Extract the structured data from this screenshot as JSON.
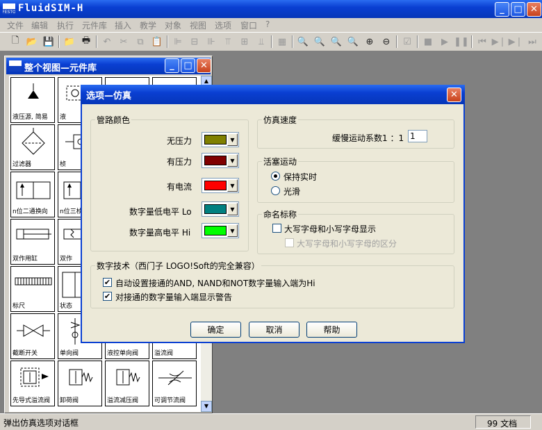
{
  "app": {
    "title": "FluidSIM-H"
  },
  "menu": [
    "文件",
    "编辑",
    "执行",
    "元件库",
    "插入",
    "教学",
    "对象",
    "视图",
    "选项",
    "窗口",
    "?"
  ],
  "toolbar": {
    "icons": [
      "new-file-icon",
      "open-folder-icon",
      "save-icon",
      "open-project-icon",
      "print-icon",
      "undo-icon",
      "cut-icon",
      "copy-icon",
      "paste-icon",
      "align-left-icon",
      "align-center-icon",
      "align-right-icon",
      "align-top-icon",
      "align-middle-icon",
      "align-bottom-icon",
      "grid-icon",
      "zoom-fit-icon",
      "zoom-prev-icon",
      "zoom-window-icon",
      "zoom-all-icon",
      "zoom-in-icon",
      "zoom-out-icon",
      "check-icon",
      "stop-icon",
      "play-icon",
      "pause-icon",
      "rewind-icon",
      "step-icon",
      "forward-icon",
      "fast-forward-icon"
    ]
  },
  "library": {
    "title": "整个视图—元件库",
    "cells": [
      {
        "label": "液压源, 简易",
        "icon": "hydraulic-source-icon"
      },
      {
        "label": "液",
        "icon": "pump-icon"
      },
      {
        "label": "",
        "icon": "blank-icon"
      },
      {
        "label": "",
        "icon": "blank-icon"
      },
      {
        "label": "过滤器",
        "icon": "filter-icon"
      },
      {
        "label": "桢",
        "icon": "valve-icon"
      },
      {
        "label": "n位二通换向",
        "icon": "way-valve-2-icon"
      },
      {
        "label": "n位三桢",
        "icon": "way-valve-3-icon"
      },
      {
        "label": "双作用缸",
        "icon": "double-acting-cylinder-icon"
      },
      {
        "label": "双作",
        "icon": "cylinder-icon"
      },
      {
        "label": "标尺",
        "icon": "scale-icon"
      },
      {
        "label": "状态",
        "icon": "state-icon"
      },
      {
        "label": "截断开关",
        "icon": "shutoff-valve-icon"
      },
      {
        "label": "单向阀",
        "icon": "check-valve-icon"
      },
      {
        "label": "液控单向阀",
        "icon": "pilot-check-valve-icon"
      },
      {
        "label": "溢流阀",
        "icon": "relief-valve-icon"
      },
      {
        "label": "先导式溢流阀",
        "icon": "pilot-relief-valve-icon"
      },
      {
        "label": "卸荷阀",
        "icon": "unloading-valve-icon"
      },
      {
        "label": "溢流减压阀",
        "icon": "pressure-reducing-valve-icon"
      },
      {
        "label": "可调节流阀",
        "icon": "throttle-valve-icon"
      }
    ]
  },
  "dialog": {
    "title": "选项—仿真",
    "pipe_colors": {
      "group": "管路颜色",
      "rows": [
        {
          "label": "无压力",
          "color": "#808000"
        },
        {
          "label": "有压力",
          "color": "#800000"
        },
        {
          "label": "有电流",
          "color": "#ff0000"
        },
        {
          "label": "数字量低电平 Lo",
          "color": "#008080"
        },
        {
          "label": "数字量高电平 Hi",
          "color": "#00ff00"
        }
      ]
    },
    "sim_speed": {
      "group": "仿真速度",
      "label": "缓慢运动系数1 ：1",
      "value": "1"
    },
    "piston": {
      "group": "活塞运动",
      "options": [
        "保持实时",
        "光滑"
      ],
      "selected": 0
    },
    "naming": {
      "group": "命名标称",
      "upper_lower": "大写字母和小写字母显示",
      "distinguish": "大写字母和小写字母的区分"
    },
    "digital": {
      "group": "数字技术（西门子 LOGO!Soft的完全兼容）",
      "auto_set": "自动设置接通的AND, NAND和NOT数字量输入端为Hi",
      "warn": "对接通的数字量输入端显示警告"
    },
    "buttons": {
      "ok": "确定",
      "cancel": "取消",
      "help": "帮助"
    }
  },
  "status": {
    "message": "弹出仿真选项对话框",
    "docs": "99 文档"
  }
}
